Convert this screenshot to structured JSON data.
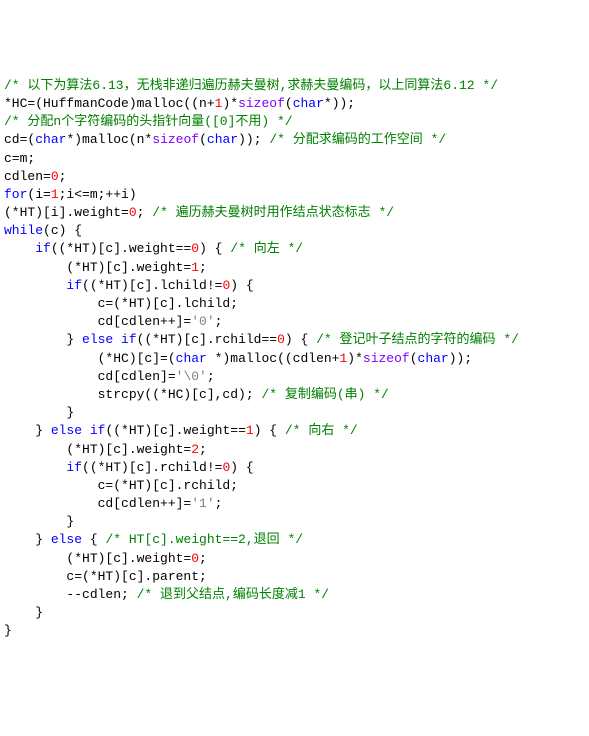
{
  "code_lines": [
    [
      [
        "cm",
        "/* 以下为算法6.13，无栈非递归遍历赫夫曼树,求赫夫曼编码，以上同算法6.12 */"
      ]
    ],
    [
      [
        "",
        "*HC=(HuffmanCode)malloc((n+"
      ],
      [
        "nm",
        "1"
      ],
      [
        "",
        ")*"
      ],
      [
        "ty",
        "sizeof"
      ],
      [
        "",
        "("
      ],
      [
        "kw",
        "char"
      ],
      [
        "",
        "*));"
      ]
    ],
    [
      [
        "cm",
        "/* 分配n个字符编码的头指针向量([0]不用) */"
      ]
    ],
    [
      [
        "",
        "cd=("
      ],
      [
        "kw",
        "char"
      ],
      [
        "",
        "*)malloc(n*"
      ],
      [
        "ty",
        "sizeof"
      ],
      [
        "",
        "("
      ],
      [
        "kw",
        "char"
      ],
      [
        "",
        ")); "
      ],
      [
        "cm",
        "/* 分配求编码的工作空间 */"
      ]
    ],
    [
      [
        "",
        "c=m;"
      ]
    ],
    [
      [
        "",
        "cdlen="
      ],
      [
        "nm",
        "0"
      ],
      [
        "",
        ";"
      ]
    ],
    [
      [
        "kw",
        "for"
      ],
      [
        "",
        "(i="
      ],
      [
        "nm",
        "1"
      ],
      [
        "",
        ";i<=m;++i)"
      ]
    ],
    [
      [
        "",
        "(*HT)[i].weight="
      ],
      [
        "nm",
        "0"
      ],
      [
        "",
        "; "
      ],
      [
        "cm",
        "/* 遍历赫夫曼树时用作结点状态标志 */"
      ]
    ],
    [
      [
        "kw",
        "while"
      ],
      [
        "",
        "(c) {"
      ]
    ],
    [
      [
        "",
        "    "
      ],
      [
        "kw",
        "if"
      ],
      [
        "",
        "((*HT)[c].weight=="
      ],
      [
        "nm",
        "0"
      ],
      [
        "",
        ") { "
      ],
      [
        "cm",
        "/* 向左 */"
      ]
    ],
    [
      [
        "",
        "        (*HT)[c].weight="
      ],
      [
        "nm",
        "1"
      ],
      [
        "",
        ";"
      ]
    ],
    [
      [
        "",
        "        "
      ],
      [
        "kw",
        "if"
      ],
      [
        "",
        "((*HT)[c].lchild!="
      ],
      [
        "nm",
        "0"
      ],
      [
        "",
        ") {"
      ]
    ],
    [
      [
        "",
        "            c=(*HT)[c].lchild;"
      ]
    ],
    [
      [
        "",
        "            cd[cdlen++]="
      ],
      [
        "st",
        "'0'"
      ],
      [
        "",
        ";"
      ]
    ],
    [
      [
        "",
        "        } "
      ],
      [
        "kw",
        "else"
      ],
      [
        "",
        ""
      ],
      [
        "",
        " "
      ],
      [
        "kw",
        "if"
      ],
      [
        "",
        "((*HT)[c].rchild=="
      ],
      [
        "nm",
        "0"
      ],
      [
        "",
        ") { "
      ],
      [
        "cm",
        "/* 登记叶子结点的字符的编码 */"
      ]
    ],
    [
      [
        "",
        "            (*HC)[c]=("
      ],
      [
        "kw",
        "char"
      ],
      [
        "",
        " *)malloc((cdlen+"
      ],
      [
        "nm",
        "1"
      ],
      [
        "",
        ")*"
      ],
      [
        "ty",
        "sizeof"
      ],
      [
        "",
        "("
      ],
      [
        "kw",
        "char"
      ],
      [
        "",
        "));"
      ]
    ],
    [
      [
        "",
        "            cd[cdlen]="
      ],
      [
        "st",
        "'\\0'"
      ],
      [
        "",
        ";"
      ]
    ],
    [
      [
        "",
        "            strcpy((*HC)[c],cd); "
      ],
      [
        "cm",
        "/* 复制编码(串) */"
      ]
    ],
    [
      [
        "",
        "        }"
      ]
    ],
    [
      [
        "",
        "    } "
      ],
      [
        "kw",
        "else"
      ],
      [
        "",
        ""
      ],
      [
        "",
        " "
      ],
      [
        "kw",
        "if"
      ],
      [
        "",
        "((*HT)[c].weight=="
      ],
      [
        "nm",
        "1"
      ],
      [
        "",
        ") { "
      ],
      [
        "cm",
        "/* 向右 */"
      ]
    ],
    [
      [
        "",
        "        (*HT)[c].weight="
      ],
      [
        "nm",
        "2"
      ],
      [
        "",
        ";"
      ]
    ],
    [
      [
        "",
        "        "
      ],
      [
        "kw",
        "if"
      ],
      [
        "",
        "((*HT)[c].rchild!="
      ],
      [
        "nm",
        "0"
      ],
      [
        "",
        ") {"
      ]
    ],
    [
      [
        "",
        "            c=(*HT)[c].rchild;"
      ]
    ],
    [
      [
        "",
        "            cd[cdlen++]="
      ],
      [
        "st",
        "'1'"
      ],
      [
        "",
        ";"
      ]
    ],
    [
      [
        "",
        "        }"
      ]
    ],
    [
      [
        "",
        "    } "
      ],
      [
        "kw",
        "else"
      ],
      [
        "",
        " { "
      ],
      [
        "cm",
        "/* HT[c].weight==2,退回 */"
      ]
    ],
    [
      [
        "",
        "        (*HT)[c].weight="
      ],
      [
        "nm",
        "0"
      ],
      [
        "",
        ";"
      ]
    ],
    [
      [
        "",
        "        c=(*HT)[c].parent;"
      ]
    ],
    [
      [
        "",
        "        --cdlen; "
      ],
      [
        "cm",
        "/* 退到父结点,编码长度减1 */"
      ]
    ],
    [
      [
        "",
        "    }"
      ]
    ],
    [
      [
        "",
        "}"
      ]
    ]
  ]
}
